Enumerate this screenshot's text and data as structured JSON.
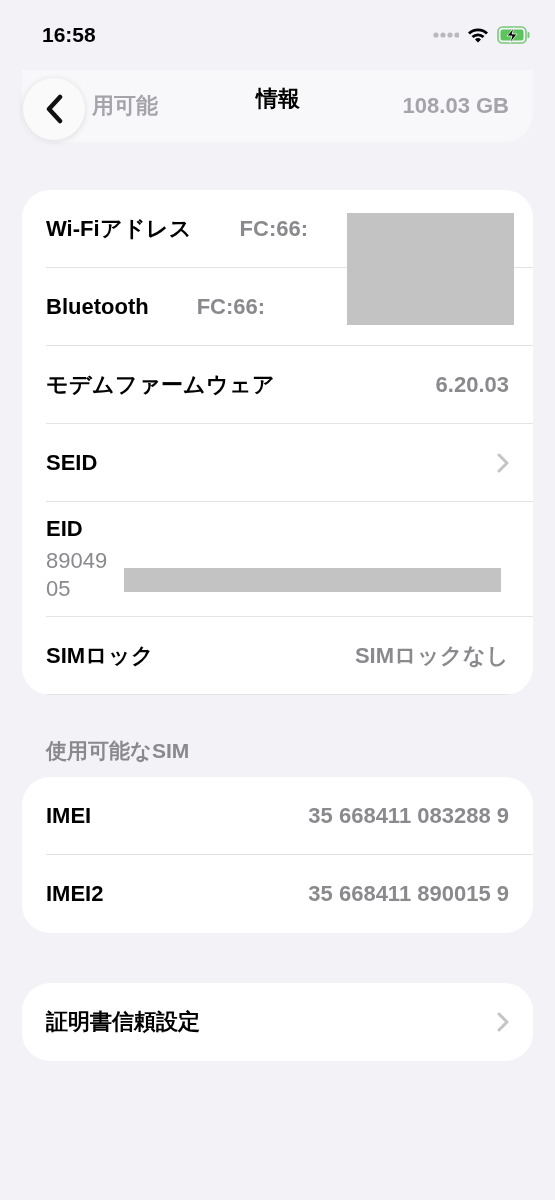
{
  "status_bar": {
    "time": "16:58"
  },
  "nav": {
    "title": "情報",
    "behind": {
      "label": "用可能",
      "value": "108.03 GB"
    }
  },
  "groups": [
    {
      "rows": [
        {
          "kind": "value",
          "label": "Wi-Fiアドレス",
          "value": "FC:66:",
          "redacted": true
        },
        {
          "kind": "value",
          "label": "Bluetooth",
          "value": "FC:66:",
          "redacted": true
        },
        {
          "kind": "value",
          "label": "モデムファームウェア",
          "value": "6.20.03"
        },
        {
          "kind": "chevron",
          "label": "SEID"
        },
        {
          "kind": "stacked",
          "label": "EID",
          "lines": [
            "89049",
            "05"
          ],
          "redacted": true
        },
        {
          "kind": "value",
          "label": "SIMロック",
          "value": "SIMロックなし"
        }
      ]
    },
    {
      "header": "使用可能なSIM",
      "rows": [
        {
          "kind": "value",
          "label": "IMEI",
          "value": "35 668411 083288 9"
        },
        {
          "kind": "value",
          "label": "IMEI2",
          "value": "35 668411 890015 9"
        }
      ]
    },
    {
      "rows": [
        {
          "kind": "chevron",
          "label": "証明書信頼設定"
        }
      ]
    }
  ]
}
